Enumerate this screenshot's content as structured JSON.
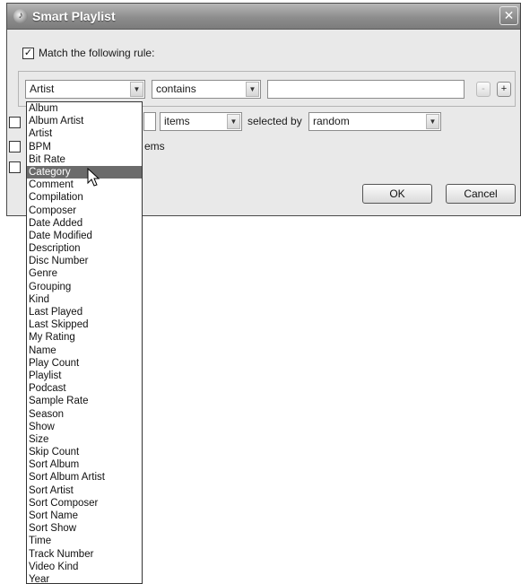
{
  "window": {
    "title": "Smart Playlist",
    "close_glyph": "✕",
    "icon": "itunes-icon"
  },
  "match_rule": {
    "checked": true,
    "label": "Match the following rule:"
  },
  "rule": {
    "field_value": "Artist",
    "operator_value": "contains",
    "text_value": "",
    "remove_glyph": "-",
    "add_glyph": "+"
  },
  "limit": {
    "unit_value": "items",
    "selected_by_label": "selected by",
    "selected_by_value": "random"
  },
  "partial_label": "ems",
  "buttons": {
    "ok": "OK",
    "cancel": "Cancel"
  },
  "field_dropdown": {
    "selected": "Category",
    "items": [
      "Album",
      "Album Artist",
      "Artist",
      "BPM",
      "Bit Rate",
      "Category",
      "Comment",
      "Compilation",
      "Composer",
      "Date Added",
      "Date Modified",
      "Description",
      "Disc Number",
      "Genre",
      "Grouping",
      "Kind",
      "Last Played",
      "Last Skipped",
      "My Rating",
      "Name",
      "Play Count",
      "Playlist",
      "Podcast",
      "Sample Rate",
      "Season",
      "Show",
      "Size",
      "Skip Count",
      "Sort Album",
      "Sort Album Artist",
      "Sort Artist",
      "Sort Composer",
      "Sort Name",
      "Sort Show",
      "Time",
      "Track Number",
      "Video Kind",
      "Year"
    ]
  }
}
